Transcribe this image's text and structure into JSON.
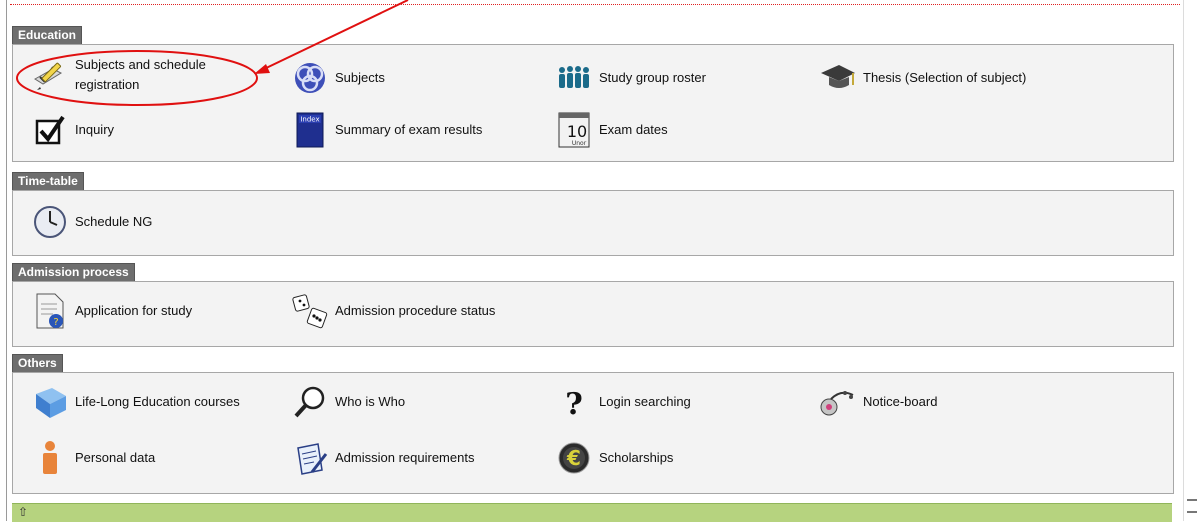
{
  "sections": [
    {
      "id": "education",
      "title": "Education",
      "items": [
        {
          "name": "subjects-and-schedule-registration",
          "label": "Subjects and schedule registration",
          "icon": "pencil-checklist-icon"
        },
        {
          "name": "subjects",
          "label": "Subjects",
          "icon": "celtic-knot-icon"
        },
        {
          "name": "study-group-roster",
          "label": "Study group roster",
          "icon": "people-group-icon"
        },
        {
          "name": "thesis",
          "label": "Thesis (Selection of subject)",
          "icon": "graduation-cap-icon"
        },
        {
          "name": "inquiry",
          "label": "Inquiry",
          "icon": "checkbox-checked-icon"
        },
        {
          "name": "summary-of-exam-results",
          "label": "Summary of exam results",
          "icon": "index-book-icon"
        },
        {
          "name": "exam-dates",
          "label": "Exam dates",
          "icon": "calendar-icon",
          "icon_text": "10",
          "icon_subtext": "Unor"
        }
      ]
    },
    {
      "id": "timetable",
      "title": "Time-table",
      "items": [
        {
          "name": "schedule-ng",
          "label": "Schedule NG",
          "icon": "clock-icon"
        }
      ]
    },
    {
      "id": "admission",
      "title": "Admission process",
      "items": [
        {
          "name": "application-for-study",
          "label": "Application for study",
          "icon": "document-question-icon"
        },
        {
          "name": "admission-procedure-status",
          "label": "Admission procedure status",
          "icon": "dice-icon"
        }
      ]
    },
    {
      "id": "others",
      "title": "Others",
      "items": [
        {
          "name": "life-long-education-courses",
          "label": "Life-Long Education courses",
          "icon": "book-cube-icon"
        },
        {
          "name": "who-is-who",
          "label": "Who is Who",
          "icon": "magnifier-icon"
        },
        {
          "name": "login-searching",
          "label": "Login searching",
          "icon": "question-mark-icon"
        },
        {
          "name": "notice-board",
          "label": "Notice-board",
          "icon": "notice-board-icon"
        },
        {
          "name": "personal-data",
          "label": "Personal data",
          "icon": "person-icon"
        },
        {
          "name": "admission-requirements",
          "label": "Admission requirements",
          "icon": "clipboard-pen-icon"
        },
        {
          "name": "scholarships",
          "label": "Scholarships",
          "icon": "euro-coin-icon"
        }
      ]
    }
  ],
  "footer": {
    "up_icon": "up-arrow-icon",
    "up_symbol": "⇧"
  },
  "colors": {
    "annotation": "#e01010",
    "section_header": "#6e6e6e",
    "footer": "#b6d37f"
  }
}
